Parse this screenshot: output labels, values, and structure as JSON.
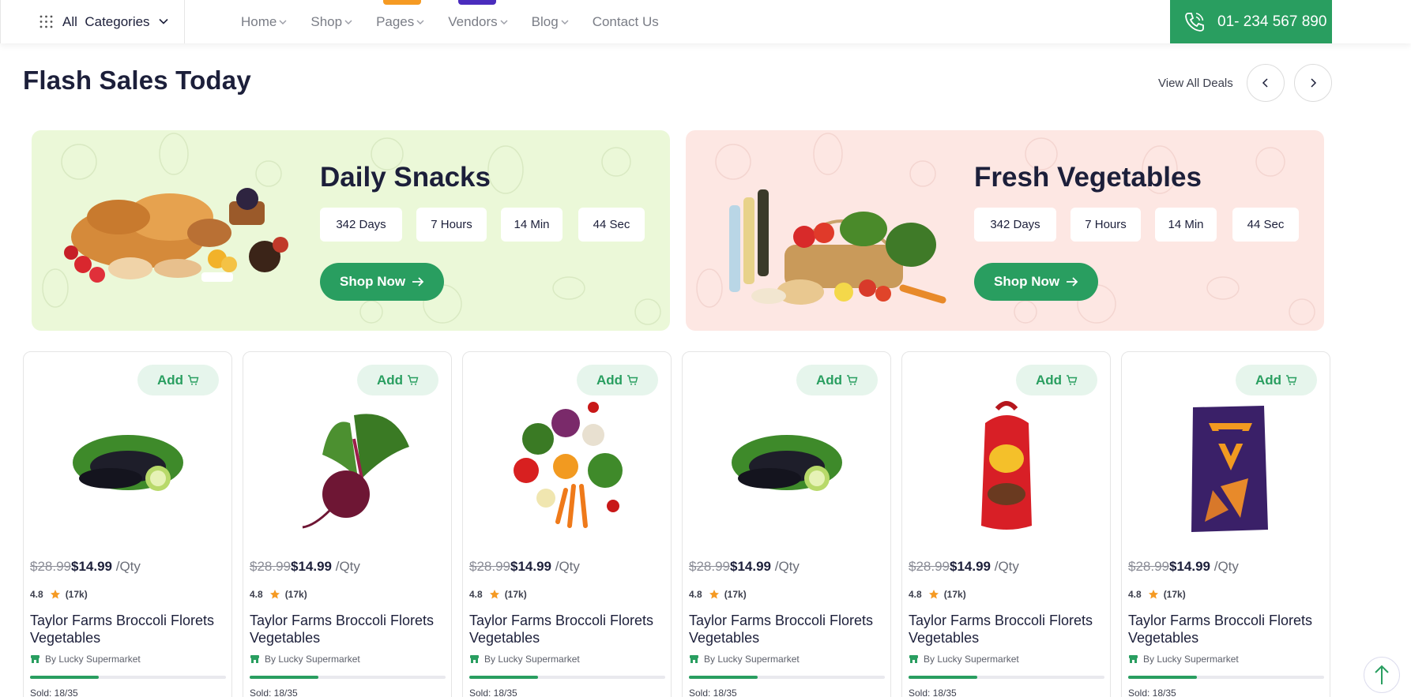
{
  "nav": {
    "categories_label": "All  Categories",
    "menu": [
      "Home",
      "Shop",
      "Pages",
      "Vendors",
      "Blog",
      "Contact Us"
    ],
    "phone": "01- 234 567 890"
  },
  "section": {
    "title": "Flash Sales Today",
    "view_all": "View All Deals"
  },
  "banners": [
    {
      "title": "Daily Snacks",
      "timer": [
        "342 Days",
        "7 Hours",
        "14 Min",
        "44 Sec"
      ],
      "button": "Shop Now"
    },
    {
      "title": "Fresh Vegetables",
      "timer": [
        "342 Days",
        "7 Hours",
        "14 Min",
        "44 Sec"
      ],
      "button": "Shop Now"
    }
  ],
  "products": [
    {
      "add": "Add",
      "old_price": "$28.99",
      "price": "$14.99",
      "unit": " /Qty",
      "rating": "4.8",
      "reviews": "(17k)",
      "name": "Taylor Farms Broccoli Florets Vegetables",
      "vendor": "By Lucky Supermarket",
      "sold": "Sold: 18/35",
      "sold_fraction": 0.35
    },
    {
      "add": "Add",
      "old_price": "$28.99",
      "price": "$14.99",
      "unit": " /Qty",
      "rating": "4.8",
      "reviews": "(17k)",
      "name": "Taylor Farms Broccoli Florets Vegetables",
      "vendor": "By Lucky Supermarket",
      "sold": "Sold: 18/35",
      "sold_fraction": 0.35
    },
    {
      "add": "Add",
      "old_price": "$28.99",
      "price": "$14.99",
      "unit": " /Qty",
      "rating": "4.8",
      "reviews": "(17k)",
      "name": "Taylor Farms Broccoli Florets Vegetables",
      "vendor": "By Lucky Supermarket",
      "sold": "Sold: 18/35",
      "sold_fraction": 0.35
    },
    {
      "add": "Add",
      "old_price": "$28.99",
      "price": "$14.99",
      "unit": " /Qty",
      "rating": "4.8",
      "reviews": "(17k)",
      "name": "Taylor Farms Broccoli Florets Vegetables",
      "vendor": "By Lucky Supermarket",
      "sold": "Sold: 18/35",
      "sold_fraction": 0.35
    },
    {
      "add": "Add",
      "old_price": "$28.99",
      "price": "$14.99",
      "unit": " /Qty",
      "rating": "4.8",
      "reviews": "(17k)",
      "name": "Taylor Farms Broccoli Florets Vegetables",
      "vendor": "By Lucky Supermarket",
      "sold": "Sold: 18/35",
      "sold_fraction": 0.35
    },
    {
      "add": "Add",
      "old_price": "$28.99",
      "price": "$14.99",
      "unit": " /Qty",
      "rating": "4.8",
      "reviews": "(17k)",
      "name": "Taylor Farms Broccoli Florets Vegetables",
      "vendor": "By Lucky Supermarket",
      "sold": "Sold: 18/35",
      "sold_fraction": 0.35
    }
  ],
  "colors": {
    "brand_green": "#299e60",
    "snack_banner": "#ebf8d8",
    "veg_banner": "#fde7e3",
    "star": "#f59a23"
  }
}
